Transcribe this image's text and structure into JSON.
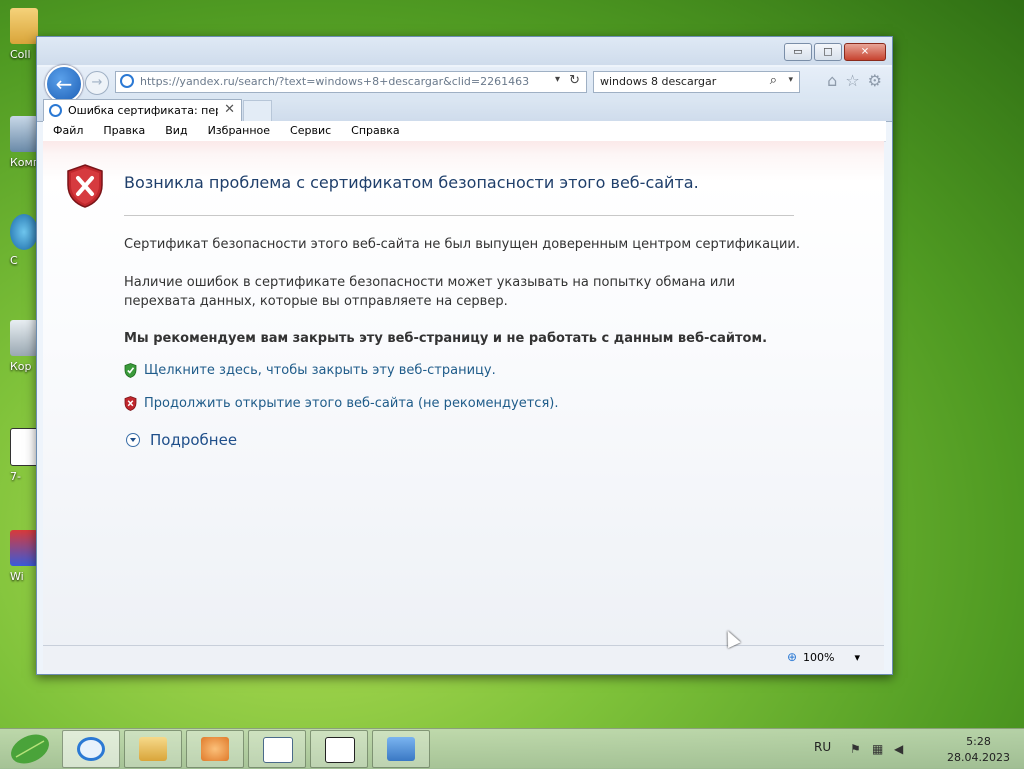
{
  "desktop": {
    "icons": [
      {
        "label": "Coll",
        "icon": "folder-icon"
      },
      {
        "label": "Комп",
        "icon": "computer-icon"
      },
      {
        "label": "С",
        "icon": "network-icon"
      },
      {
        "label": "Кор",
        "icon": "recycle-bin-icon"
      },
      {
        "label": "7-",
        "icon": "7zip-icon"
      },
      {
        "label": "Wi",
        "icon": "app-shortcut-icon"
      }
    ]
  },
  "window": {
    "controls": {
      "minimize": "▭",
      "maximize": "□",
      "close": "✕"
    },
    "address": {
      "url": "https://yandex.ru/search/?text=windows+8+descargar&clid=2261463",
      "refresh_glyph": "↻",
      "dropdown_glyph": "▾"
    },
    "search": {
      "value": "windows 8 descargar",
      "button_glyph": "⌕",
      "dropdown_glyph": "▾"
    },
    "toolbar_icons": {
      "home": "⌂",
      "favorites": "☆",
      "tools": "⚙"
    },
    "tab": {
      "title": "Ошибка сертификата: пер...",
      "close_glyph": "✕"
    },
    "menu": [
      "Файл",
      "Правка",
      "Вид",
      "Избранное",
      "Сервис",
      "Справка"
    ],
    "page": {
      "headline": "Возникла проблема с сертификатом безопасности этого веб-сайта.",
      "p1": "Сертификат безопасности этого веб-сайта не был выпущен доверенным центром сертификации.",
      "p2": "Наличие ошибок в сертификате безопасности может указывать на попытку обмана или перехвата данных, которые вы отправляете на сервер.",
      "recommend": "Мы рекомендуем вам закрыть эту веб-страницу и не работать с данным веб-сайтом.",
      "link_close": "Щелкните здесь, чтобы закрыть эту веб-страницу.",
      "link_continue": "Продолжить открытие этого веб-сайта (не рекомендуется).",
      "details": "Подробнее"
    },
    "status": {
      "zoom": "100%",
      "zoom_dropdown": "▾"
    }
  },
  "taskbar": {
    "buttons": [
      {
        "name": "internet-explorer",
        "color": "#2b79d4"
      },
      {
        "name": "file-explorer",
        "color": "#e0b64a"
      },
      {
        "name": "media-player",
        "color": "#e07a2a"
      },
      {
        "name": "notepad-window",
        "color": "#4a6a8a"
      },
      {
        "name": "7zip",
        "color": "#222222"
      },
      {
        "name": "remote-desktop",
        "color": "#3a78c4"
      }
    ],
    "language": "RU",
    "time": "5:28",
    "date": "28.04.2023"
  },
  "colors": {
    "accent": "#2b79d4",
    "headline": "#1f3f6b",
    "link": "#1f5c8a",
    "shield_red": "#c0272d",
    "shield_green": "#3a9a3a"
  }
}
